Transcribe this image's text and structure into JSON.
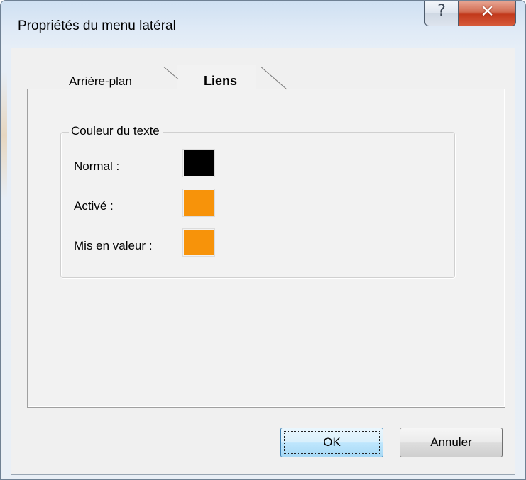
{
  "window": {
    "title": "Propriétés du menu latéral",
    "help_glyph": "?",
    "close_glyph": "✕"
  },
  "tabs": [
    {
      "label": "Arrière-plan",
      "active": false
    },
    {
      "label": "Liens",
      "active": true
    }
  ],
  "group": {
    "title": "Couleur du texte",
    "rows": [
      {
        "label": "Normal :",
        "color": "#000000"
      },
      {
        "label": "Activé :",
        "color": "#f7930a"
      },
      {
        "label": "Mis en valeur :",
        "color": "#f7930a"
      }
    ]
  },
  "buttons": {
    "ok_label": "OK",
    "cancel_label": "Annuler"
  }
}
